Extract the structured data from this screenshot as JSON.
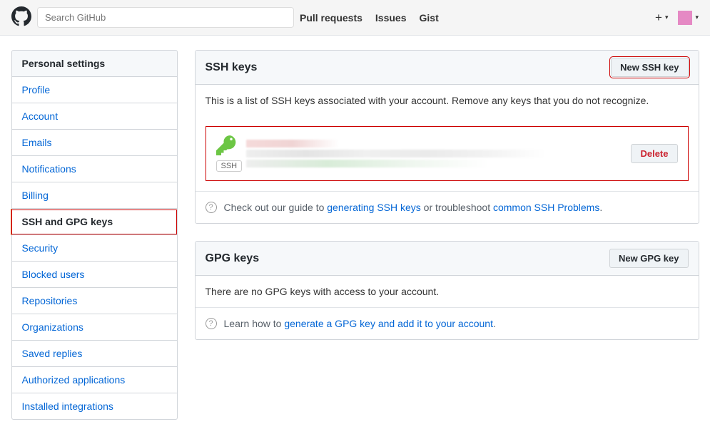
{
  "header": {
    "search_placeholder": "Search GitHub",
    "nav": [
      "Pull requests",
      "Issues",
      "Gist"
    ]
  },
  "sidebar": {
    "title": "Personal settings",
    "items": [
      {
        "label": "Profile",
        "active": false
      },
      {
        "label": "Account",
        "active": false
      },
      {
        "label": "Emails",
        "active": false
      },
      {
        "label": "Notifications",
        "active": false
      },
      {
        "label": "Billing",
        "active": false
      },
      {
        "label": "SSH and GPG keys",
        "active": true
      },
      {
        "label": "Security",
        "active": false
      },
      {
        "label": "Blocked users",
        "active": false
      },
      {
        "label": "Repositories",
        "active": false
      },
      {
        "label": "Organizations",
        "active": false
      },
      {
        "label": "Saved replies",
        "active": false
      },
      {
        "label": "Authorized applications",
        "active": false
      },
      {
        "label": "Installed integrations",
        "active": false
      }
    ]
  },
  "ssh": {
    "title": "SSH keys",
    "new_btn": "New SSH key",
    "desc": "This is a list of SSH keys associated with your account. Remove any keys that you do not recognize.",
    "badge": "SSH",
    "delete_btn": "Delete",
    "guide_pre": "Check out our guide to ",
    "guide_link1": "generating SSH keys",
    "guide_mid": " or troubleshoot ",
    "guide_link2": "common SSH Problems",
    "guide_post": "."
  },
  "gpg": {
    "title": "GPG keys",
    "new_btn": "New GPG key",
    "desc": "There are no GPG keys with access to your account.",
    "guide_pre": "Learn how to ",
    "guide_link": "generate a GPG key and add it to your account",
    "guide_post": "."
  }
}
